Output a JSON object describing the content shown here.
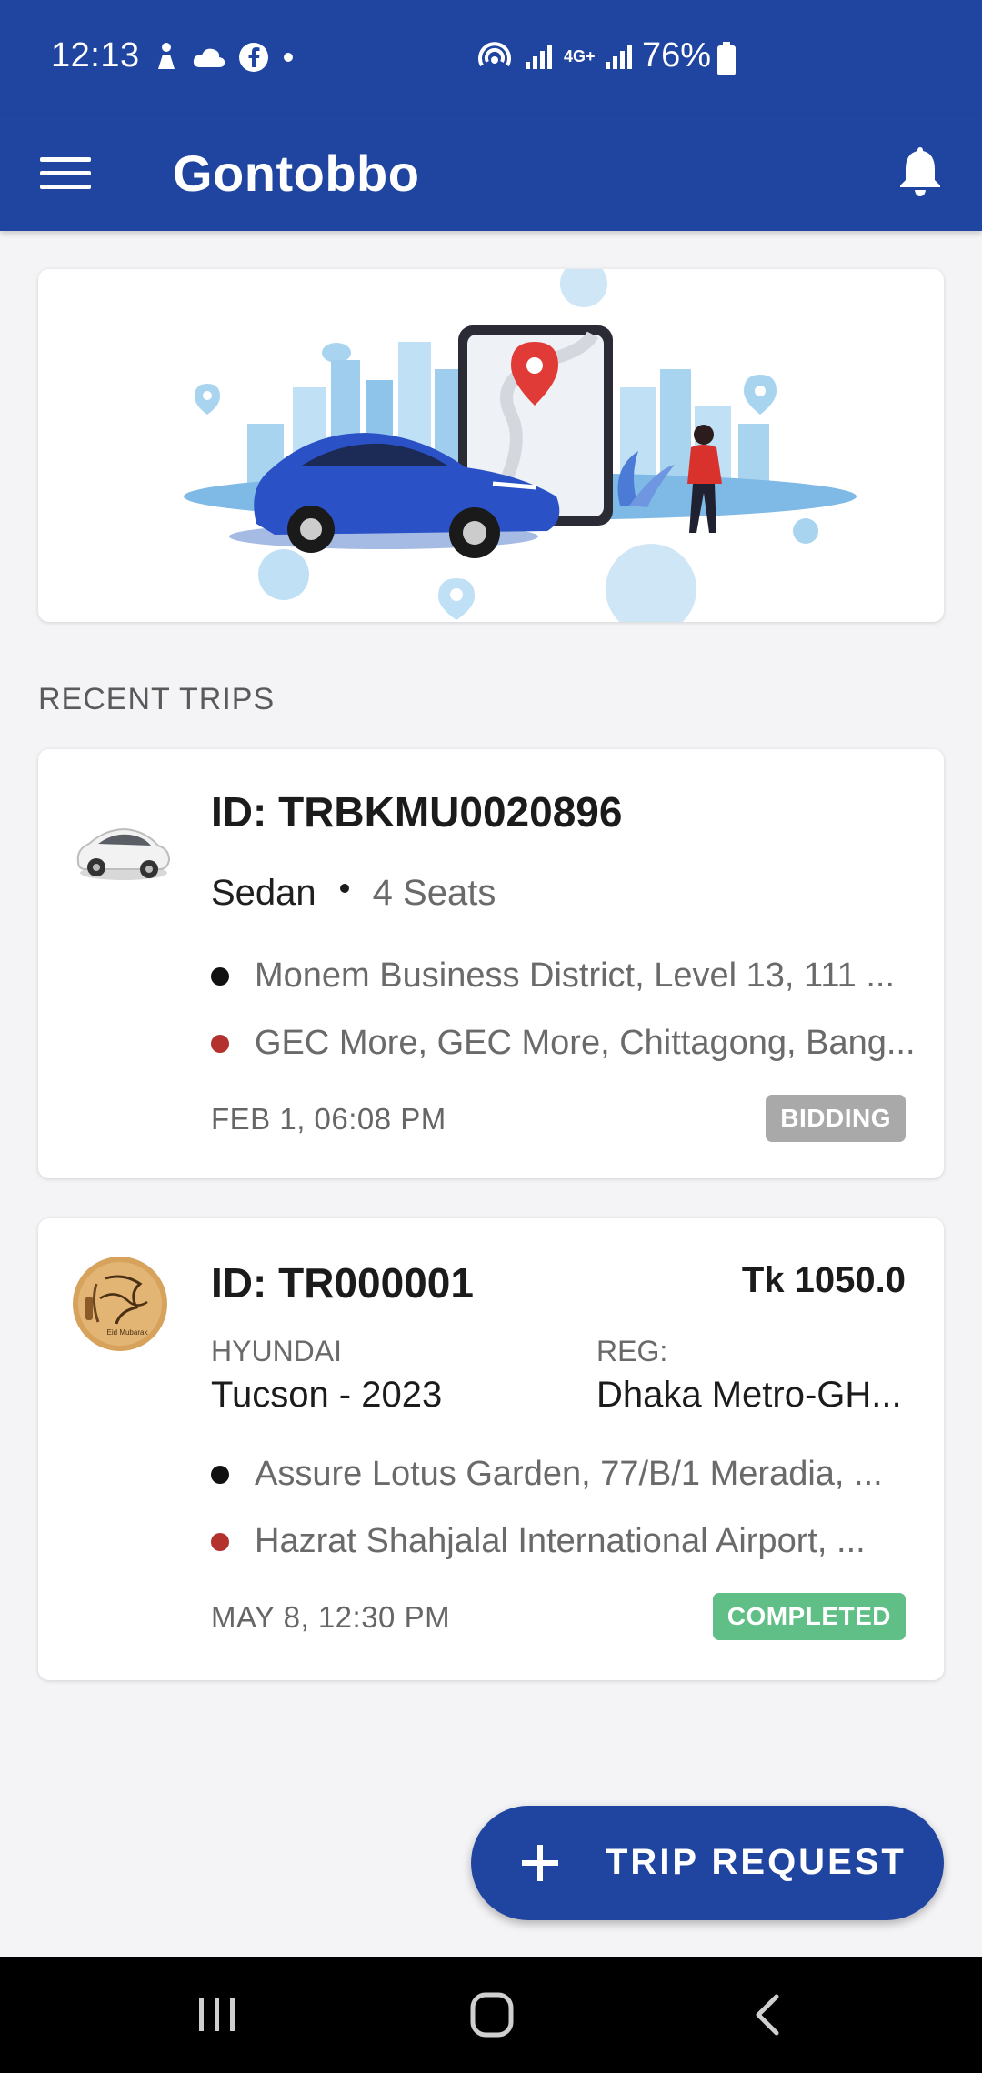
{
  "status_bar": {
    "time": "12:13",
    "battery": "76%",
    "network": "4G+"
  },
  "app_bar": {
    "title": "Gontobbo",
    "background_color": "#2045a1"
  },
  "section": {
    "recent_trips": "RECENT TRIPS"
  },
  "trips": [
    {
      "id": "ID: TRBKMU0020896",
      "vehicle_type": "Sedan",
      "seats": "4 Seats",
      "pickup": "Monem Business District, Level 13, 111 ...",
      "dropoff": "GEC More, GEC More, Chittagong, Bang...",
      "datetime": "FEB 1, 06:08 PM",
      "status": "BIDDING",
      "status_color": "#a9a9a9",
      "thumb_icon": "sedan-car-image"
    },
    {
      "id": "ID: TR000001",
      "fare": "Tk 1050.0",
      "make_label": "HYUNDAI",
      "model": "Tucson - 2023",
      "reg_label": "REG:",
      "reg_value": "Dhaka Metro-GH...",
      "pickup": "Assure Lotus Garden, 77/B/1 Meradia, ...",
      "dropoff": "Hazrat Shahjalal International Airport, ...",
      "datetime": "MAY 8, 12:30 PM",
      "status": "COMPLETED",
      "status_color": "#5fbf86",
      "thumb_icon": "eid-mubarak-avatar",
      "thumb_caption": "Eid Mubarak"
    }
  ],
  "fab": {
    "label": "TRIP REQUEST"
  },
  "nav": {
    "recents": "recents-icon",
    "home": "home-icon",
    "back": "back-icon"
  }
}
